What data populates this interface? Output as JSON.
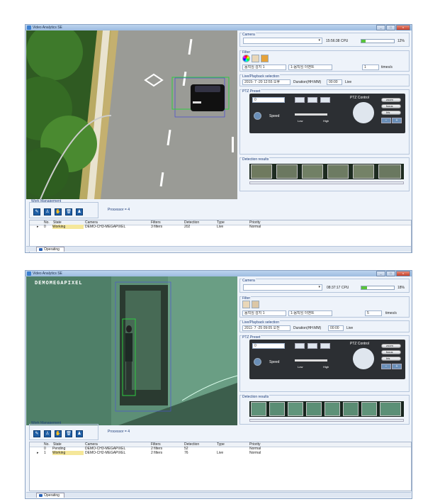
{
  "window_top": {
    "title": "Video Analytics SE",
    "camera_label": "Camera",
    "clock": "15:56:38 CPU",
    "cpu_percent": 12,
    "cpu_text": "12%",
    "filter_label": "Filter",
    "filter_select_1": "움직임 감지 1",
    "filter_select_2": "1-움직임 이벤트",
    "filter_spin_value": "1",
    "filter_unit": "times/s",
    "live_label": "Live/Playback selection",
    "date_value": "2015- 7 -20 12:55 오후",
    "duration_label": "Duration(HH:MM)",
    "duration_value": "00:00",
    "mode": "Live",
    "ptz_label": "PTZ Preset",
    "ptz_select": "0",
    "ptz_control": "PTZ Control",
    "speed_label": "Speed",
    "speed_low": "Low",
    "speed_high": "High",
    "zoom_label": "zoom",
    "focus_label": "focus",
    "iris_label": "Iris",
    "minus_label": "−",
    "plus_label": "+",
    "detection_label": "Detection results",
    "work_label": "Work Management",
    "processor_text": "Processor = 4",
    "columns": [
      "No.",
      "State",
      "Camera",
      "Filters",
      "Detection",
      "Type",
      "Priority"
    ],
    "rows": [
      {
        "no": "0",
        "state": "Working",
        "camera": "DEMO-CH3-MEGAPIXEL",
        "filters": "3 filters",
        "detection": "202",
        "type": "Live",
        "priority": "Normal"
      }
    ],
    "tab_label": "Operating"
  },
  "window_bottom": {
    "title": "Video Analytics SE",
    "overlay_label": "DEMOMEGAPIXEL",
    "camera_label": "Camera",
    "clock": "08:37:17 CPU",
    "cpu_percent": 18,
    "cpu_text": "18%",
    "filter_label": "Filter",
    "filter_select_1": "움직임 감지 1",
    "filter_select_2": "1-움직임 이벤트",
    "filter_spin_value": "5",
    "filter_unit": "times/s",
    "live_label": "Live/Playback selection",
    "date_value": "2011- 7 -25 09:05 오전",
    "duration_label": "Duration(HH:MM)",
    "duration_value": "00:00",
    "mode": "Live",
    "ptz_label": "PTZ Preset",
    "ptz_select": "0",
    "ptz_control": "PTZ Control",
    "speed_label": "Speed",
    "speed_low": "Low",
    "speed_high": "High",
    "zoom_label": "zoom",
    "focus_label": "focus",
    "iris_label": "Iris",
    "minus_label": "−",
    "plus_label": "+",
    "detection_label": "Detection results",
    "work_label": "Work Management",
    "processor_text": "Processor = 4",
    "columns": [
      "No.",
      "State",
      "Camera",
      "Filters",
      "Detection",
      "Type",
      "Priority"
    ],
    "rows": [
      {
        "no": "0",
        "state": "Pending",
        "camera": "DEMO-CH3-MEGAPIXEL",
        "filters": "2 filters",
        "detection": "52",
        "type": "",
        "priority": "Normal"
      },
      {
        "no": "1",
        "state": "Working",
        "camera": "DEMO-CH2-MEGAPIXEL",
        "filters": "2 filters",
        "detection": "76",
        "type": "Live",
        "priority": "Normal"
      }
    ],
    "tab_label": "Operating"
  },
  "colors": {
    "accent": "#1f5fa6",
    "cpu_fill": "#58c33a",
    "roi_green": "#2ecc40",
    "roi_blue": "#4a4ae0"
  },
  "icons": [
    "color-wheel-icon",
    "person-filter-icon",
    "crowd-filter-icon",
    "snapshot-icon",
    "rotate-icon",
    "trash-icon",
    "edit-icon",
    "person-icon",
    "hand-icon",
    "delete-icon",
    "users-icon"
  ]
}
